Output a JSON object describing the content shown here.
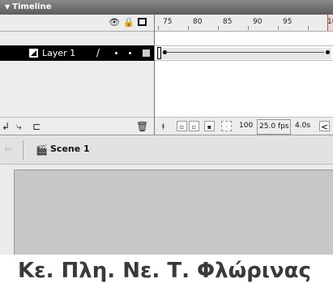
{
  "panel": {
    "title": "Timeline"
  },
  "layers": [
    {
      "name": "Layer 1",
      "selected": true
    }
  ],
  "ruler": {
    "ticks": [
      "75",
      "80",
      "85",
      "90",
      "95",
      "10"
    ]
  },
  "status": {
    "current_frame": "100",
    "frame_rate": "25.0 fps",
    "elapsed": "4.0s"
  },
  "scene": {
    "name": "Scene 1"
  },
  "caption": {
    "text": "Κε. Πλη. Νε. Τ. Φλώρινας"
  },
  "icons": [
    "eye-icon",
    "lock-icon",
    "outline-icon",
    "insert-layer-icon",
    "add-motion-guide-icon",
    "insert-folder-icon",
    "trash-icon",
    "center-frame-icon",
    "onion-skin-icon",
    "onion-outline-icon",
    "edit-multiple-frames-icon",
    "onion-markers-icon",
    "back-arrow-icon",
    "scene-icon",
    "pencil-icon"
  ],
  "colors": {
    "panel_bg": "#ececec",
    "selected_row": "#000000",
    "stage": "#c7c7c7"
  }
}
